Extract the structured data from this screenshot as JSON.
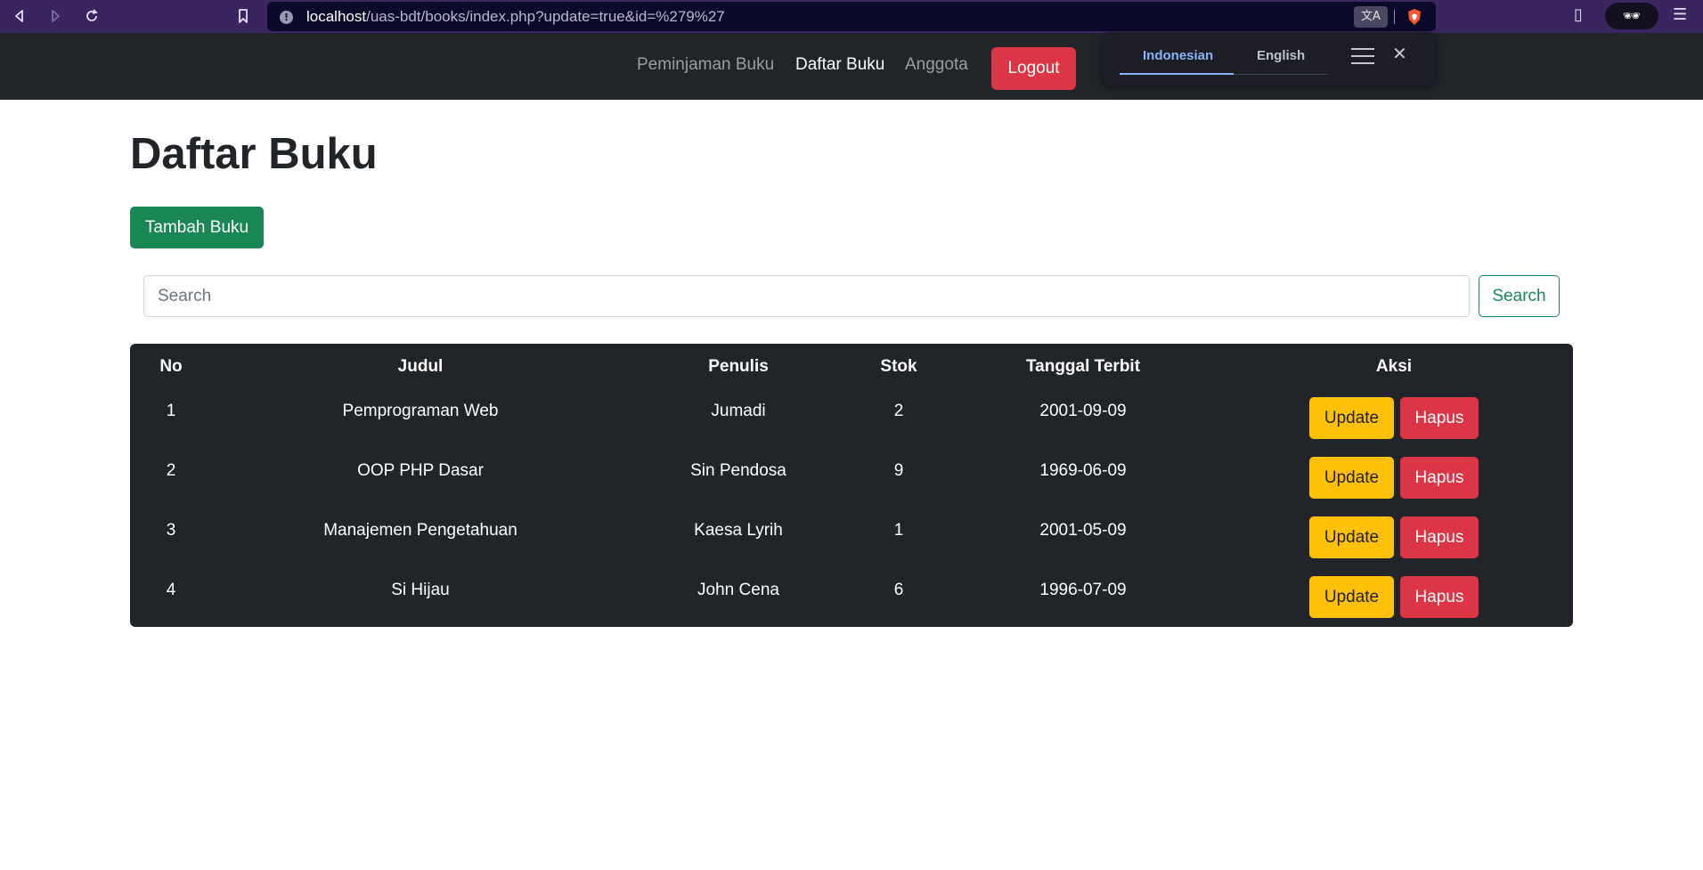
{
  "browser": {
    "url_host": "localhost",
    "url_path": "/uas-bdt/books/index.php?update=true&id=%279%27",
    "translate_icon": "translate-icon",
    "info_icon": "info-icon"
  },
  "navbar": {
    "links": [
      "Peminjaman Buku",
      "Daftar Buku",
      "Anggota"
    ],
    "active": "Daftar Buku",
    "logout_label": "Logout"
  },
  "translate_popup": {
    "tab_active": "Indonesian",
    "tab_inactive": "English"
  },
  "page": {
    "title": "Daftar Buku",
    "add_label": "Tambah Buku",
    "search_placeholder": "Search",
    "search_button": "Search"
  },
  "table": {
    "headers": [
      "No",
      "Judul",
      "Penulis",
      "Stok",
      "Tanggal Terbit",
      "Aksi"
    ],
    "rows": [
      {
        "no": "1",
        "judul": "Pemprograman Web",
        "penulis": "Jumadi",
        "stok": "2",
        "tanggal": "2001-09-09"
      },
      {
        "no": "2",
        "judul": "OOP PHP Dasar",
        "penulis": "Sin Pendosa",
        "stok": "9",
        "tanggal": "1969-06-09"
      },
      {
        "no": "3",
        "judul": "Manajemen Pengetahuan",
        "penulis": "Kaesa Lyrih",
        "stok": "1",
        "tanggal": "2001-05-09"
      },
      {
        "no": "4",
        "judul": "Si Hijau",
        "penulis": "John Cena",
        "stok": "6",
        "tanggal": "1996-07-09"
      }
    ],
    "update_label": "Update",
    "hapus_label": "Hapus"
  },
  "colors": {
    "navbar": "#212529",
    "danger": "#dc3545",
    "success": "#198754",
    "warning": "#ffc107"
  }
}
